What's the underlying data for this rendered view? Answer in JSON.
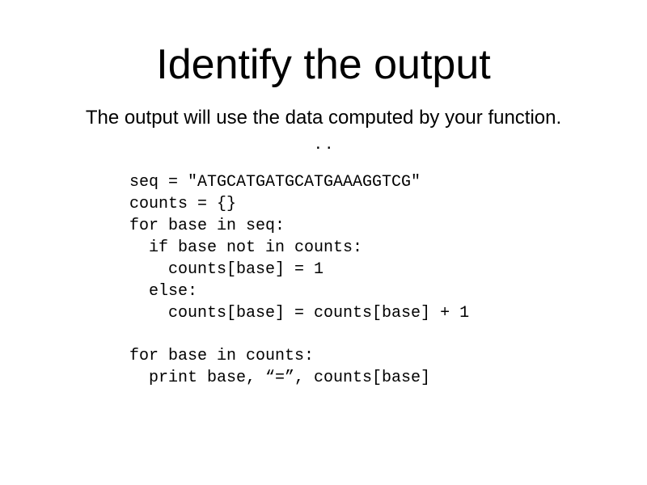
{
  "title": "Identify the output",
  "subtitle": "The output will use the data computed by your function. . .",
  "code1": "seq = \"ATGCATGATGCATGAAAGGTCG\"\ncounts = {}\nfor base in seq:\n  if base not in counts:\n    counts[base] = 1\n  else:\n    counts[base] = counts[base] + 1",
  "code2": "for base in counts:\n  print base, “=”, counts[base]"
}
